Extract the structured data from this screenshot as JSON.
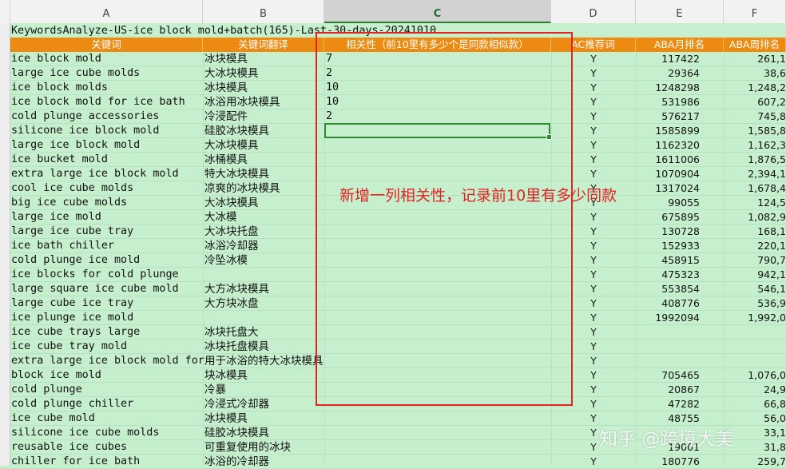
{
  "column_letters": [
    "A",
    "B",
    "C",
    "D",
    "E",
    "F"
  ],
  "selected_column": "C",
  "sheet_title": "KeywordsAnalyze-US-ice block mold+batch(165)-Last-30-days-20241010",
  "headers": [
    "关键词",
    "关键词翻译",
    "相关性（前10里有多少个是同款相似款）",
    "AC推荐词",
    "ABA月排名",
    "ABA周排名"
  ],
  "rows": [
    {
      "kw": "ice block mold",
      "tr": "冰块模具",
      "rel": "7",
      "ac": "Y",
      "month": "117422",
      "week": "261,1"
    },
    {
      "kw": "large ice cube molds",
      "tr": "大冰块模具",
      "rel": "2",
      "ac": "Y",
      "month": "29364",
      "week": "38,6"
    },
    {
      "kw": "ice block molds",
      "tr": "冰块模具",
      "rel": "10",
      "ac": "Y",
      "month": "1248298",
      "week": "1,248,2"
    },
    {
      "kw": "ice block mold for ice bath",
      "tr": "冰浴用冰块模具",
      "rel": "10",
      "ac": "Y",
      "month": "531986",
      "week": "607,2"
    },
    {
      "kw": "cold plunge accessories",
      "tr": "冷浸配件",
      "rel": "2",
      "ac": "Y",
      "month": "576217",
      "week": "745,8"
    },
    {
      "kw": "silicone ice block mold",
      "tr": "硅胶冰块模具",
      "rel": "",
      "ac": "Y",
      "month": "1585899",
      "week": "1,585,8"
    },
    {
      "kw": "large ice block mold",
      "tr": "大冰块模具",
      "rel": "",
      "ac": "Y",
      "month": "1162320",
      "week": "1,162,3"
    },
    {
      "kw": "ice bucket mold",
      "tr": "冰桶模具",
      "rel": "",
      "ac": "Y",
      "month": "1611006",
      "week": "1,876,5"
    },
    {
      "kw": "extra large ice block mold",
      "tr": "特大冰块模具",
      "rel": "",
      "ac": "Y",
      "month": "1070904",
      "week": "2,394,1"
    },
    {
      "kw": "cool ice cube molds",
      "tr": "凉爽的冰块模具",
      "rel": "",
      "ac": "Y",
      "month": "1317024",
      "week": "1,678,4"
    },
    {
      "kw": "big ice cube molds",
      "tr": "大冰块模具",
      "rel": "",
      "ac": "Y",
      "month": "99055",
      "week": "124,5"
    },
    {
      "kw": "large ice mold",
      "tr": "大冰模",
      "rel": "",
      "ac": "Y",
      "month": "675895",
      "week": "1,082,9"
    },
    {
      "kw": "large ice cube tray",
      "tr": "大冰块托盘",
      "rel": "",
      "ac": "Y",
      "month": "130728",
      "week": "168,1"
    },
    {
      "kw": "ice bath chiller",
      "tr": "冰浴冷却器",
      "rel": "",
      "ac": "Y",
      "month": "152933",
      "week": "220,1"
    },
    {
      "kw": "cold plunge ice mold",
      "tr": "冷坠冰模",
      "rel": "",
      "ac": "Y",
      "month": "458915",
      "week": "790,7"
    },
    {
      "kw": "ice blocks for cold plunge",
      "tr": "",
      "rel": "",
      "ac": "Y",
      "month": "475323",
      "week": "942,1"
    },
    {
      "kw": "large square ice cube mold",
      "tr": "大方冰块模具",
      "rel": "",
      "ac": "Y",
      "month": "553854",
      "week": "546,1"
    },
    {
      "kw": "large cube ice tray",
      "tr": "大方块冰盘",
      "rel": "",
      "ac": "Y",
      "month": "408776",
      "week": "536,9"
    },
    {
      "kw": "ice plunge ice mold",
      "tr": "",
      "rel": "",
      "ac": "Y",
      "month": "1992094",
      "week": "1,992,0"
    },
    {
      "kw": "ice cube trays large",
      "tr": "冰块托盘大",
      "rel": "",
      "ac": "Y",
      "month": "",
      "week": ""
    },
    {
      "kw": "ice cube tray mold",
      "tr": "冰块托盘模具",
      "rel": "",
      "ac": "Y",
      "month": "",
      "week": ""
    },
    {
      "kw": "extra large ice block mold for",
      "tr": "用于冰浴的特大冰块模具",
      "rel": "",
      "ac": "Y",
      "month": "",
      "week": ""
    },
    {
      "kw": "block ice mold",
      "tr": "块冰模具",
      "rel": "",
      "ac": "Y",
      "month": "705465",
      "week": "1,076,0"
    },
    {
      "kw": "cold plunge",
      "tr": "冷暴",
      "rel": "",
      "ac": "Y",
      "month": "20867",
      "week": "24,9"
    },
    {
      "kw": "cold plunge chiller",
      "tr": "冷浸式冷却器",
      "rel": "",
      "ac": "Y",
      "month": "47282",
      "week": "66,8"
    },
    {
      "kw": "ice cube mold",
      "tr": "冰块模具",
      "rel": "",
      "ac": "Y",
      "month": "48755",
      "week": "56,0"
    },
    {
      "kw": "silicone ice cube molds",
      "tr": "硅胶冰块模具",
      "rel": "",
      "ac": "Y",
      "month": "",
      "week": "33,1"
    },
    {
      "kw": "reusable ice cubes",
      "tr": "可重复使用的冰块",
      "rel": "",
      "ac": "Y",
      "month": "19001",
      "week": "31,8"
    },
    {
      "kw": "chiller for ice bath",
      "tr": "冰浴的冷却器",
      "rel": "",
      "ac": "Y",
      "month": "180776",
      "week": "259,7"
    }
  ],
  "annotation": "新增一列相关性，记录前10里有多少同款",
  "watermark": "知乎 @跨境大美",
  "colors": {
    "header_orange": "#ed8a12",
    "cell_green": "#c6efce",
    "annotation_red": "#e32222",
    "selection_green": "#2e8b2e"
  }
}
